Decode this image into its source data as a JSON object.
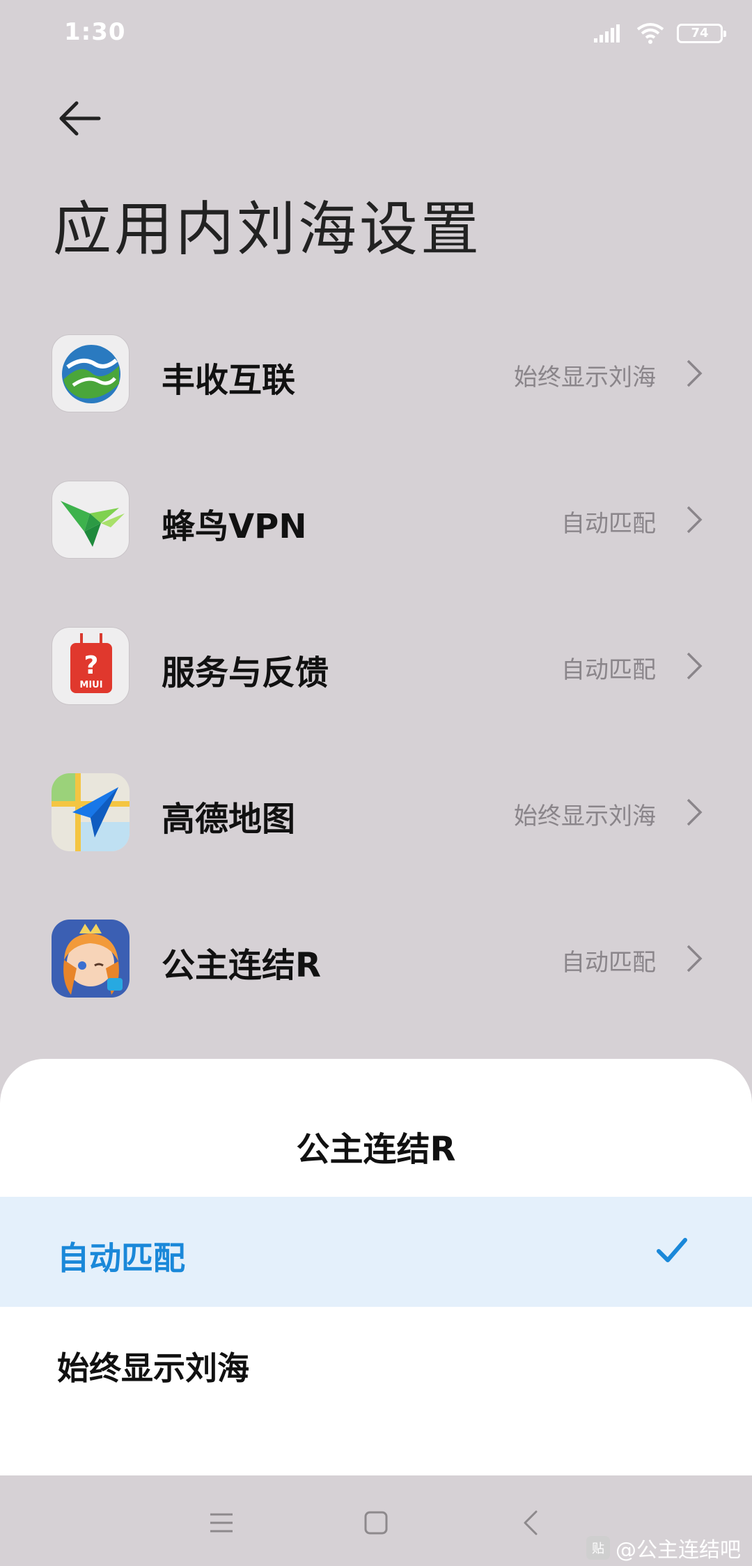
{
  "status_bar": {
    "time": "1:30",
    "battery": "74",
    "icons": [
      "signal-icon",
      "wifi-icon",
      "battery-icon"
    ]
  },
  "header": {
    "title": "应用内刘海设置",
    "back_icon": "arrow-left-icon"
  },
  "apps": [
    {
      "name": "丰收互联",
      "status": "始终显示刘海",
      "icon": "fengshou-app-icon"
    },
    {
      "name": "蜂鸟VPN",
      "status": "自动匹配",
      "icon": "hummingbird-app-icon"
    },
    {
      "name": "服务与反馈",
      "status": "自动匹配",
      "icon": "miui-feedback-app-icon"
    },
    {
      "name": "高德地图",
      "status": "始终显示刘海",
      "icon": "amap-app-icon"
    },
    {
      "name": "公主连结R",
      "status": "自动匹配",
      "icon": "princess-connect-app-icon"
    }
  ],
  "sheet": {
    "title": "公主连结R",
    "options": [
      {
        "label": "自动匹配",
        "selected": true
      },
      {
        "label": "始终显示刘海",
        "selected": false
      }
    ],
    "accent": "#1a88d9"
  },
  "feedback_icon_text": "MIUI",
  "watermark": {
    "badge": "贴",
    "text": "@公主连结吧"
  }
}
